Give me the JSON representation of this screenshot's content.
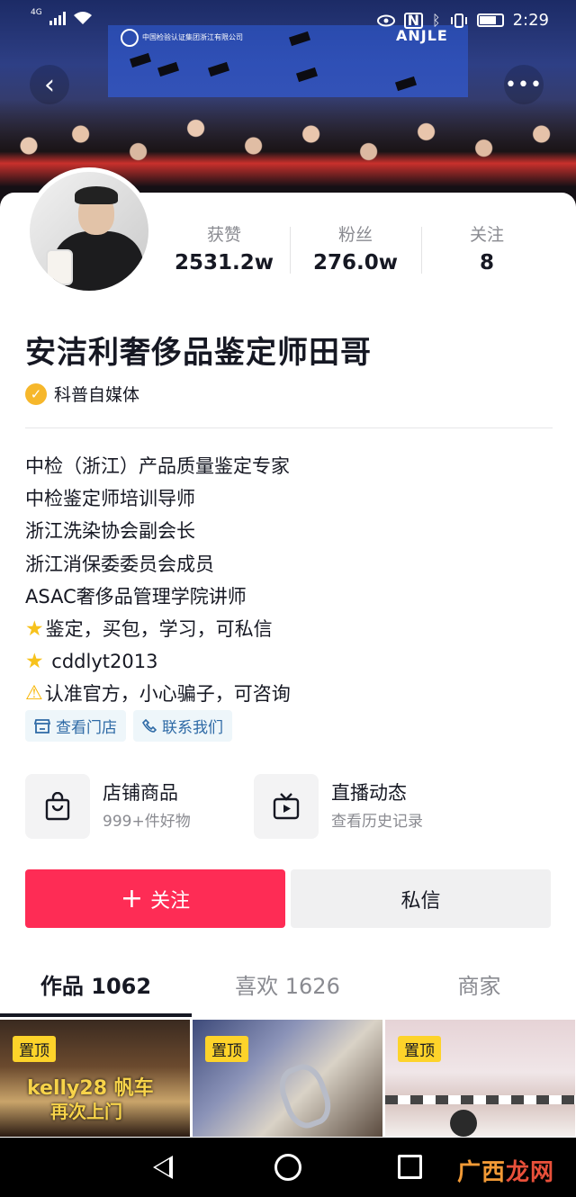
{
  "status_bar": {
    "network": "4G",
    "time": "2:29"
  },
  "cover": {
    "banner_text": "中国检验认证集团浙江有限公司",
    "brand_text": "ANJLE"
  },
  "stats": [
    {
      "label": "获赞",
      "value": "2531.2w"
    },
    {
      "label": "粉丝",
      "value": "276.0w"
    },
    {
      "label": "关注",
      "value": "8"
    }
  ],
  "profile": {
    "nickname": "安洁利奢侈品鉴定师田哥",
    "verification": "科普自媒体"
  },
  "bio": [
    {
      "icon": "",
      "text": "中检（浙江）产品质量鉴定专家"
    },
    {
      "icon": "",
      "text": "中检鉴定师培训导师"
    },
    {
      "icon": "",
      "text": "浙江洗染协会副会长"
    },
    {
      "icon": "",
      "text": "浙江消保委委员会成员"
    },
    {
      "icon": "",
      "text": "ASAC奢侈品管理学院讲师"
    },
    {
      "icon": "star",
      "text": "鉴定，买包，学习，可私信"
    },
    {
      "icon": "star",
      "text": " cddlyt2013"
    },
    {
      "icon": "warning",
      "text": "认准官方，小心骗子，可咨询"
    }
  ],
  "tags": [
    {
      "icon": "store-icon",
      "label": "查看门店"
    },
    {
      "icon": "phone-icon",
      "label": "联系我们"
    }
  ],
  "entries": [
    {
      "icon": "shopping-bag-icon",
      "title": "店铺商品",
      "subtitle": "999+件好物"
    },
    {
      "icon": "tv-play-icon",
      "title": "直播动态",
      "subtitle": "查看历史记录"
    }
  ],
  "actions": {
    "follow": "关注",
    "message": "私信"
  },
  "tabs": [
    {
      "label": "作品 1062",
      "active": true
    },
    {
      "label": "喜欢 1626",
      "active": false
    },
    {
      "label": "商家",
      "active": false
    }
  ],
  "videos": [
    {
      "pin": "置顶",
      "title": "kelly28 帆车",
      "subtitle": "再次上门"
    },
    {
      "pin": "置顶",
      "title": "",
      "subtitle": ""
    },
    {
      "pin": "置顶",
      "title": "",
      "subtitle": ""
    }
  ],
  "watermark": {
    "part1": "广西",
    "part2": "龙网"
  },
  "colors": {
    "accent": "#fe2c55",
    "verify": "#f6b72b",
    "tag_text": "#2e6aa6",
    "pin": "#fdd32a"
  }
}
